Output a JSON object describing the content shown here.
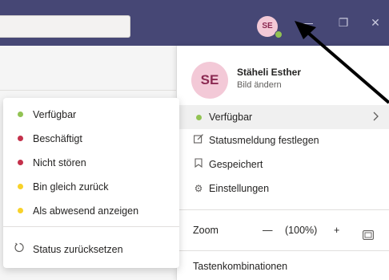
{
  "titlebar": {
    "avatar_initials": "SE",
    "presence_color": "#92c353",
    "minimize_icon": "—",
    "restore_icon": "❐",
    "close_icon": "✕"
  },
  "profile": {
    "initials": "SE",
    "name": "Stäheli Esther",
    "sub": "Bild ändern"
  },
  "menu": {
    "current_status": "Verfügbar",
    "status_message": "Statusmeldung festlegen",
    "saved": "Gespeichert",
    "settings": "Einstellungen",
    "zoom_label": "Zoom",
    "zoom_minus": "—",
    "zoom_value": "(100%)",
    "zoom_plus": "+",
    "shortcuts": "Tastenkombinationen"
  },
  "status_options": [
    {
      "label": "Verfügbar",
      "color": "#92c353"
    },
    {
      "label": "Beschäftigt",
      "color": "#c4314b"
    },
    {
      "label": "Nicht stören",
      "color": "#c4314b"
    },
    {
      "label": "Bin gleich zurück",
      "color": "#f8d22a"
    },
    {
      "label": "Als abwesend anzeigen",
      "color": "#f8d22a"
    }
  ],
  "reset_label": "Status zurücksetzen",
  "colors": {
    "titlebar": "#464775",
    "available": "#92c353",
    "busy": "#c4314b",
    "away": "#f8d22a"
  }
}
